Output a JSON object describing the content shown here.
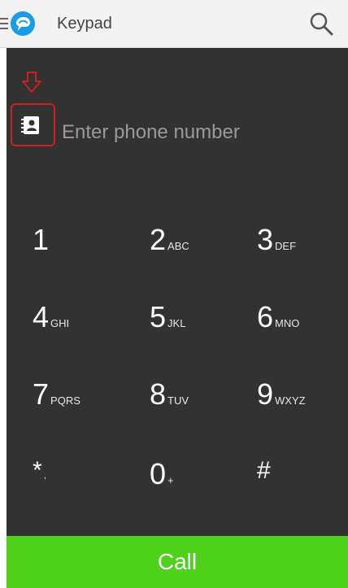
{
  "header": {
    "title": "Keypad",
    "menu_icon": "hamburger-menu-icon",
    "logo_icon": "app-logo-icon",
    "search_icon": "search-icon"
  },
  "dialer": {
    "input_placeholder": "Enter phone number",
    "input_value": "",
    "contact_icon": "contacts-book-icon",
    "annotation_arrow_icon": "down-arrow-icon",
    "keys": [
      {
        "digit": "1",
        "letters": ""
      },
      {
        "digit": "2",
        "letters": "ABC"
      },
      {
        "digit": "3",
        "letters": "DEF"
      },
      {
        "digit": "4",
        "letters": "GHI"
      },
      {
        "digit": "5",
        "letters": "JKL"
      },
      {
        "digit": "6",
        "letters": "MNO"
      },
      {
        "digit": "7",
        "letters": "PQRS"
      },
      {
        "digit": "8",
        "letters": "TUV"
      },
      {
        "digit": "9",
        "letters": "WXYZ"
      },
      {
        "digit": "*",
        "letters": ","
      },
      {
        "digit": "0",
        "letters": "+"
      },
      {
        "digit": "#",
        "letters": ""
      }
    ]
  },
  "call_button": {
    "label": "Call"
  },
  "colors": {
    "header_bg": "#f2f2f2",
    "dialer_bg": "#323232",
    "call_green": "#4fd01a",
    "annotation_red": "#cc1f1f",
    "brand_blue": "#1a9be8"
  }
}
